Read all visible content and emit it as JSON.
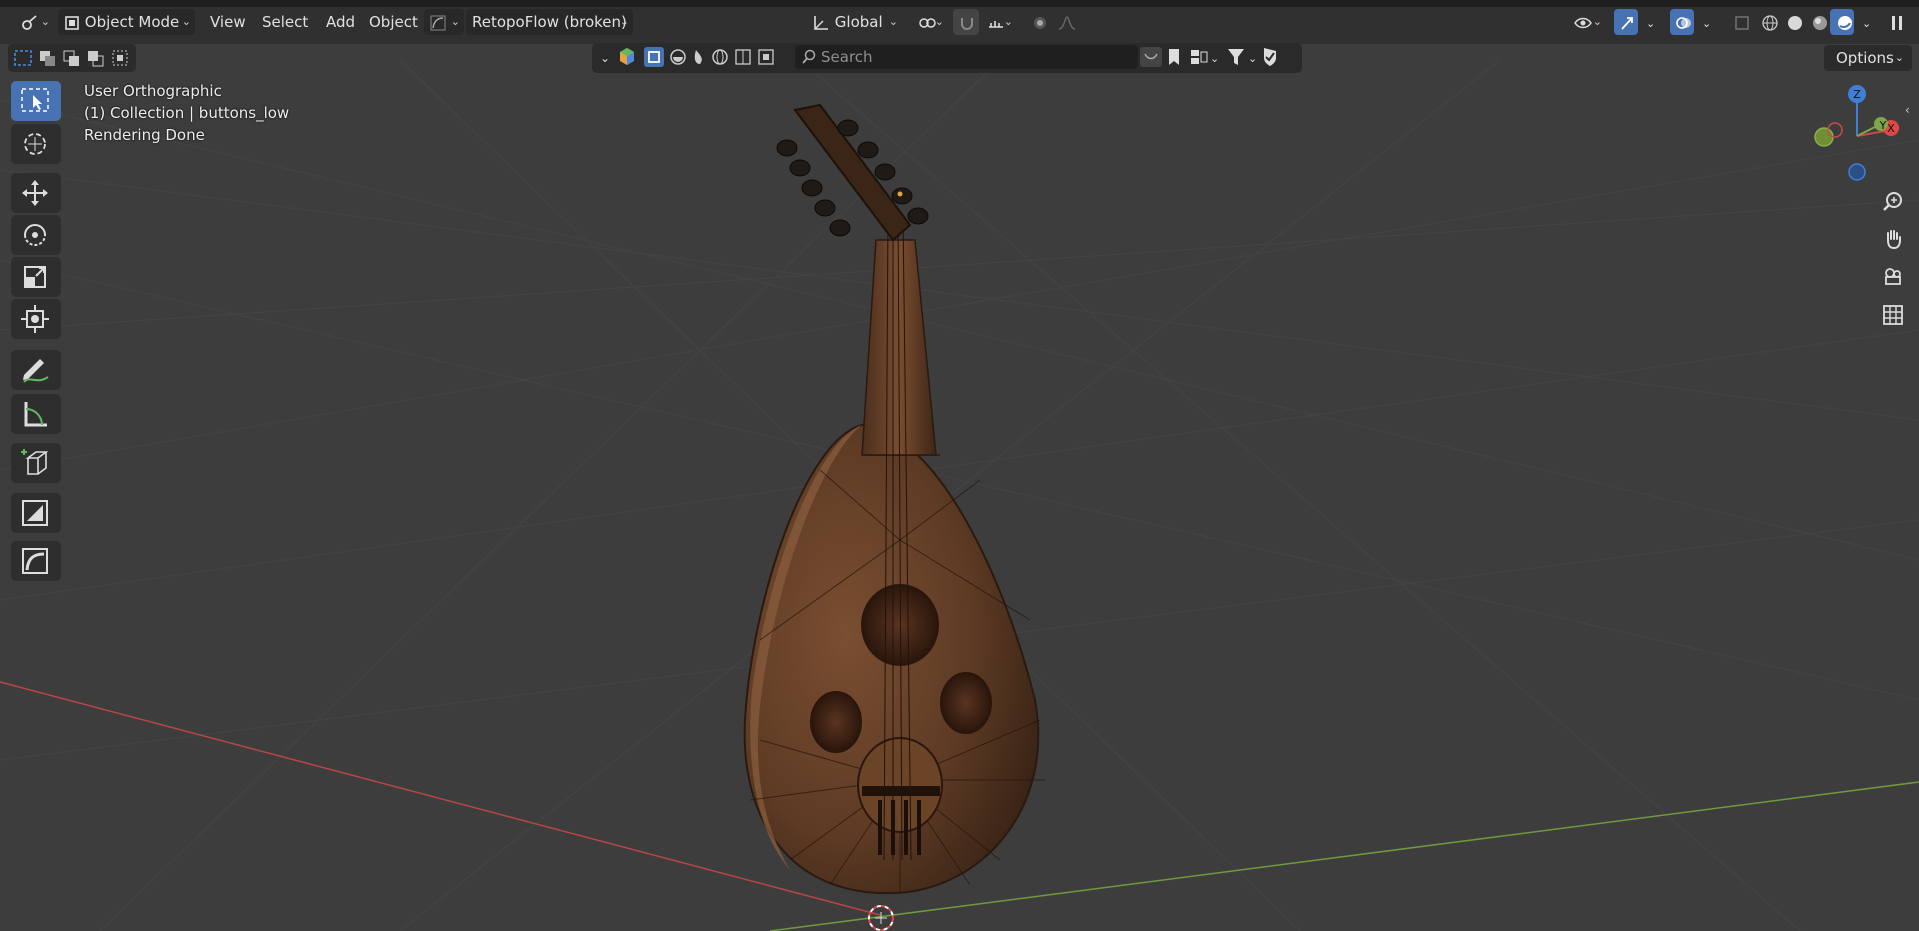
{
  "header": {
    "mode_label": "Object Mode",
    "menu": [
      "View",
      "Select",
      "Add",
      "Object"
    ],
    "addon_label": "RetopoFlow (broken)",
    "transform_orientation": "Global"
  },
  "toolbar2": {
    "search_placeholder": "Search",
    "options_label": "Options"
  },
  "overlay": {
    "view_name": "User Orthographic",
    "collection_info": "(1) Collection | buttons_low",
    "status": "Rendering Done"
  },
  "gizmo": {
    "z": "Z",
    "y": "Y",
    "x": "X"
  },
  "colors": {
    "header_bg": "#303030",
    "viewport_bg": "#3d3d3d",
    "active_blue": "#4772b3",
    "x_axis": "#c84a4a",
    "y_axis": "#7ea64a",
    "z_axis": "#3f7fd6",
    "wood": "#6b4328"
  }
}
